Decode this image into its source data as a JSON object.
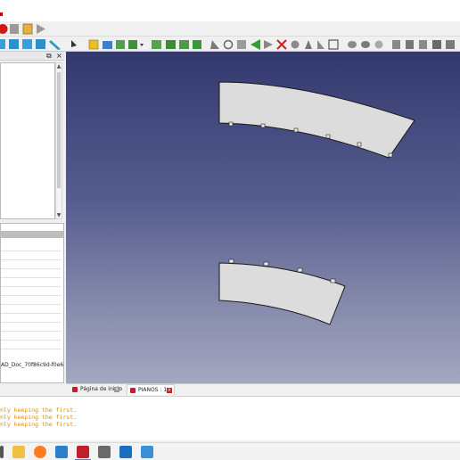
{
  "colors": {
    "viewport_top": "#33396e",
    "viewport_bottom": "#a4a7c0",
    "part_fill": "#dcdcdc",
    "report_text": "#e08a00",
    "freecad_red": "#c0202a"
  },
  "toolbar": {
    "row1_icons": [
      "freecad-record-icon",
      "stop-macro-icon",
      "edit-macro-icon",
      "run-macro-icon"
    ],
    "row2_icons": [
      "view-fit-icon",
      "view-box-icon",
      "view-front-icon",
      "view-iso-icon",
      "measure-icon",
      "what-is-this-icon",
      "part-cube-icon",
      "folder-icon",
      "export-icon",
      "import-icon",
      "dropdown-arrow-icon",
      "group-icon",
      "link-icon",
      "link-group-icon",
      "part-icon",
      "sketch-icon",
      "constraint-icon",
      "pad-icon",
      "pocket-icon",
      "fillet-icon",
      "chamfer-icon",
      "boolean-icon",
      "cut-icon",
      "mirror-icon",
      "pattern-icon",
      "shell-icon",
      "loft-icon",
      "sweep-icon",
      "section-icon",
      "offset-icon",
      "thickness-icon",
      "check-icon",
      "defeature-icon"
    ]
  },
  "left_panel": {
    "float_symbol": "⧉",
    "close_symbol": "×",
    "doc_label": "AD_Doc_70f86c9d-f0e6-..."
  },
  "tabs": [
    {
      "label": "Página de inicio",
      "active": false
    },
    {
      "label": "PIANOS : 1",
      "active": true
    }
  ],
  "report": {
    "lines": [
      "nly keeping the first.",
      "nly keeping the first.",
      "nly keeping the first."
    ]
  },
  "taskbar": {
    "apps": [
      "windows-start-icon",
      "file-explorer-icon",
      "firefox-icon",
      "edge-icon",
      "freecad-icon",
      "calculator-icon",
      "mail-icon",
      "photos-icon"
    ]
  }
}
